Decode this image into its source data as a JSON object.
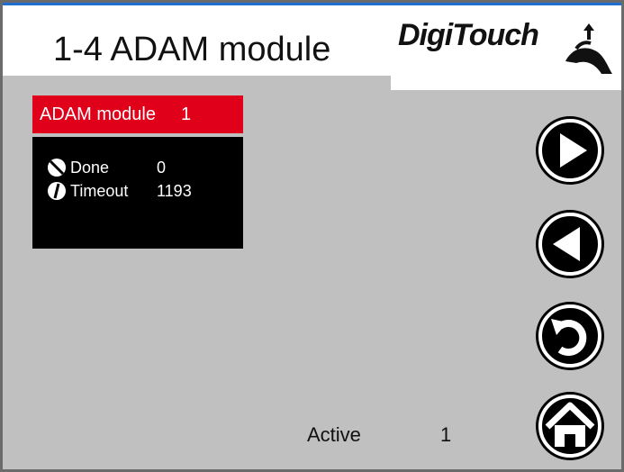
{
  "header": {
    "title": "1-4 ADAM module",
    "logo_text": "DigiTouch"
  },
  "panel": {
    "label": "ADAM module",
    "number": "1",
    "rows": [
      {
        "label": "Done",
        "value": "0"
      },
      {
        "label": "Timeout",
        "value": "1193"
      }
    ]
  },
  "status": {
    "label": "Active",
    "value": "1"
  },
  "colors": {
    "accent": "#e0001a",
    "background": "#c0c0c0",
    "panel": "#000000"
  },
  "icons": [
    "next-icon",
    "previous-icon",
    "back-icon",
    "home-icon"
  ]
}
